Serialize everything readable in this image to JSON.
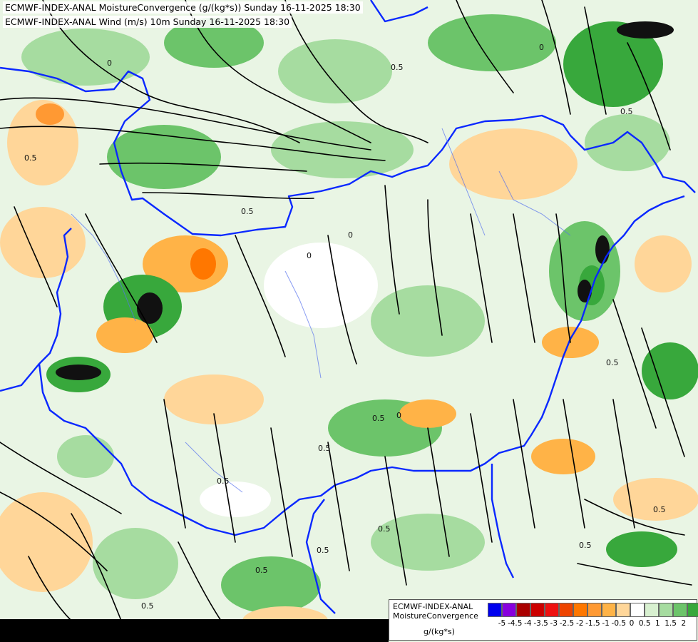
{
  "header": {
    "line1": "ECMWF-INDEX-ANAL MoistureConvergence (g/(kg*s)) Sunday 16-11-2025 18:30",
    "line2": "ECMWF-INDEX-ANAL Wind (m/s) 10m Sunday 16-11-2025 18:30"
  },
  "legend": {
    "title": "ECMWF-INDEX-ANAL MoistureConvergence",
    "unit": "g/(kg*s)",
    "colors": [
      "#0000ee",
      "#8800dd",
      "#aa0000",
      "#cc0000",
      "#ee1111",
      "#ee4400",
      "#ff7700",
      "#ff9933",
      "#ffb347",
      "#ffd699",
      "#ffffff",
      "#d8f0d0",
      "#a6dca0",
      "#6cc46a",
      "#38a83c",
      "#0f8f1f"
    ],
    "ticks": [
      "-5",
      "-4.5",
      "-4",
      "-3.5",
      "-3",
      "-2.5",
      "-2",
      "-1.5",
      "-1",
      "-0.5",
      "0",
      "0.5",
      "1",
      "1.5",
      "2"
    ]
  },
  "contour_labels": [
    "0",
    "0.5",
    "0",
    "0.5",
    "0.5",
    "0",
    "0.5",
    "0.5",
    "0",
    "0.5",
    "0.5",
    "0.5",
    "0",
    "0.5",
    "0.5",
    "0.5",
    "0.5",
    "0.5",
    "0.5"
  ]
}
